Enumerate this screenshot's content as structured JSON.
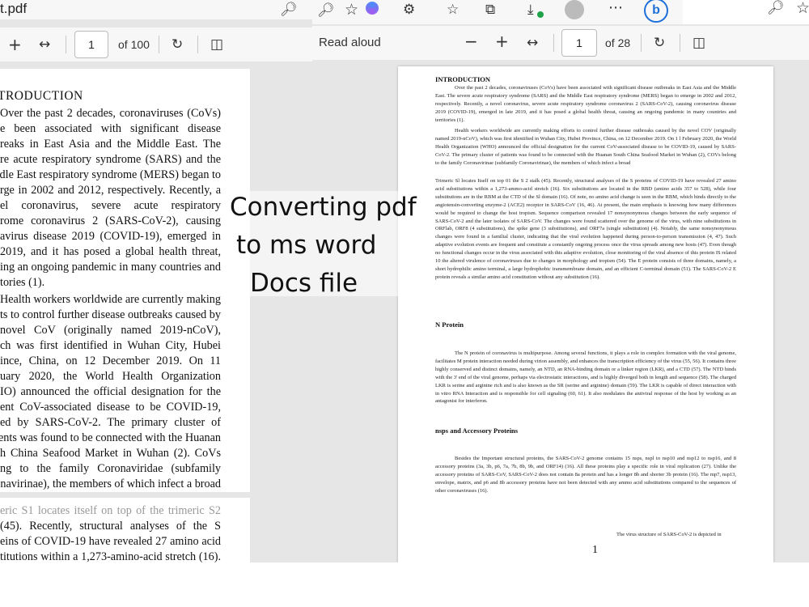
{
  "left_window": {
    "tab_title": "t.pdf",
    "toolbar": {
      "page_value": "1",
      "page_total": "of 100"
    },
    "page_lines": [
      "TRODUCTION",
      "Over the past 2 decades, coronaviruses (CoVs)",
      "e been associated with significant disease",
      "reaks in East Asia and the Middle East. The",
      "re acute respiratory syndrome (SARS) and the",
      "dle East respiratory syndrome (MERS) began to",
      "rge in 2002 and 2012, respectively. Recently, a",
      "el coronavirus, severe acute respiratory",
      "rome coronavirus 2 (SARS-CoV-2), causing",
      "avirus disease 2019 (COVID-19), emerged in",
      "2019, and it has posed a global health threat,",
      "ing an ongoing pandemic in many countries and",
      "tories (1).",
      "Health workers worldwide are currently making",
      "rts to control further disease outbreaks caused by",
      "novel CoV (originally named 2019-nCoV),",
      "ch was first identified in Wuhan City, Hubei",
      "ince, China, on 12 December 2019. On 11",
      "uary 2020, the World Health Organization",
      "IO) announced the official designation for the",
      "ent CoV-associated disease to be COVID-19,",
      "ed by SARS-CoV-2. The primary cluster of",
      "ents was found to be connected with the Huanan",
      "h China Seafood Market in Wuhan (2). CoVs",
      "ng to the family Coronaviridae (subfamily",
      "onavirinae), the members of which infect a broad"
    ],
    "page2_lines": [
      "eric S1 locates itself on top of the trimeric S2",
      "(45). Recently, structural analyses of the S",
      "eins of COVID-19 have revealed 27 amino acid",
      "titutions within a 1,273-amino-acid stretch (16)."
    ]
  },
  "right_window": {
    "read_aloud_label": "Read aloud",
    "page_value": "1",
    "page_total": "of 28",
    "document": {
      "heading_intro": "INTRODUCTION",
      "para1": "Over the past 2 decades, coronaviruses (CoVs) have been associated with significant disease outbreaks in East Asia and the Middle East. The severe acute respiratory syndrome (SARS) and the Middle East respiratory syndrome (MERS) began to emerge in 2002 and 2012, respectively. Recently, a novel coronavirus, severe acute respiratory syndrome coronavirus 2 (SARS-CoV-2), causing coronavirus disease 2019 (COVID-19), emerged in late 2019, and it has posed a global health threat, causing an ongoing pandemic in many countries and territories (1).",
      "para2": "Health workers worldwide are currently making efforts to control further disease outbreaks caused by the novel COV (originally named 2019-nCoV), which was first identified in Wuhan City, Hubei Province, China, on 12 December 2019. On 1 l February 2020, the World Health Organization (WHO) announced the official designation for the current CoV-associated disease to be COVID-19, caused by SARS-CoV-2. The primary cluster of patients was found to be connected with the Huanan South China Seafood Market in Wuhan (2), COVs belong to the family Coronavirinae (subfamily Coronavirinae), the members of which infect a broad",
      "para3": "Trimeric Sl locates Itself on top 01 the S 2 stalk (45). Recently, structural analyses of the S proteins of COVID-19 have revealed 27 amino acid substitutions within a 1,273-ammo-acid stretch (16). Six substitutions are located in the RBD (amino acids 357 to 528), while four substitutions are in the RBM at the CTD of the Sl domain (16). Of note, no amino acid change is seen in the RBM, which binds directly to the angiotensin-converting enzyme-2 (ACE2) receptor in SARS-CoV (16, 46). At present, the main emphasis is knowing how many differences would be required to change the host tropism. Sequence comparison revealed 17 nonsynonymous changes between the early sequence of SARS-CoV-2 and the later isolates of SARS-CoV. The changes were found scattered over the genome of the virus, with nine substitutions in ORFlab, ORF8 (4 substitutions), the spike gene (3 substitutions), and ORF7a (single substitution) (4). Notably, the same nonsynonymous changes were found in a familial cluster, indicating that the viral evolution happened during person-to-person transmission (4, 47). Such adaptive evolution events are frequent and constitute a constantly ongoing process once the virus spreads among new hosts (47). Even though no functional changes occur in the virus associated with this adaptive evolution, close monitoring of the viral absence of this protein IS related 10 the altered virulence of coronaviruses due to changes in morphology and tropism (54). The E protein consists of three domains, namely, a short hydrophilic amino terminal, a large hydrophobic transmembrane domain, and an efficient C-terminal domain (51). The SARS-CoV-2 E protein reveals a similar amino acid constitution without any substitution (16).",
      "heading_n": "N Protein",
      "para4": "The N protein of coronavirus is multipurpose. Among several functions, it plays a role in complex formation with the viral genome, facilitates M protein interaction needed during virion assembly, and enhances the transcription efficiency of the virus (55, 56). It contains three highly conserved and distinct domains, namely, an NTD, an RNA-binding domain or a linker region (LKR), and a CTD (57). The NTD binds with the 3' end of the viral genome, perhaps via electrostatic interactions, and is highly diverged both in length and sequence (58). The charged LKR is serine and arginine rich and is also known as the SR (serine and arginine) domain (59). The LKR is capable of direct interaction with in vitro RNA Interaction and is responsible for cell signaling (60, 61). It also modulates the antiviral response of the host by working as an antagonist for interferon.",
      "heading_nsps": "nsps and Accessory Proteins",
      "para5": "Besides the Important structural proteins, the SARS-CoV-2 genome contains 15 nsps, nspl to nsp10 and nsp12 to nsp16, and 8 accessory proteins (3a, 3b, p6, 7a, 7b, 8b, 9b, and ORF14) (16). All these proteins play a specific role in viral replication (27). Unlike the accessory proteins of SARS-CoV, SARS-CoV-2 does not contain 8a protein and has a longer 8b and shorter 3b protein (16). The mp7, nsp13, envelope, matrix, and p6 and 8b accessory proteins have not been detected with any ammo acid substitutions compared to the sequences of other coronaviruses (16).",
      "footer_text": "The virus structure of SARS-CoV-2 is depicted in",
      "page_number": "1"
    }
  },
  "caption": {
    "line1": "Converting pdf",
    "line2": "to ms word",
    "line3": "Docs file"
  },
  "colors": {
    "toolbar_bg": "#f7f7f7",
    "viewer_bg": "#e6e6e6",
    "bing_blue": "#1e6fd9"
  }
}
